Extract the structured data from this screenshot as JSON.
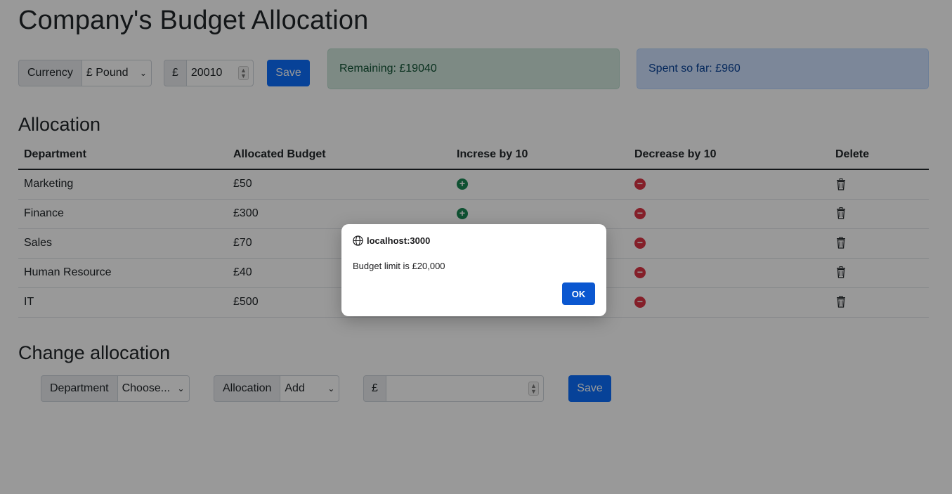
{
  "page": {
    "title": "Company's Budget Allocation"
  },
  "budget_controls": {
    "currency_label": "Currency",
    "currency_selected": "£ Pound",
    "budget_symbol": "£",
    "budget_value": "20010",
    "save_label": "Save"
  },
  "status": {
    "remaining": "Remaining: £19040",
    "spent": "Spent so far: £960"
  },
  "allocation": {
    "heading": "Allocation",
    "columns": [
      "Department",
      "Allocated Budget",
      "Increse by 10",
      "Decrease by 10",
      "Delete"
    ],
    "rows": [
      {
        "department": "Marketing",
        "budget": "£50"
      },
      {
        "department": "Finance",
        "budget": "£300"
      },
      {
        "department": "Sales",
        "budget": "£70"
      },
      {
        "department": "Human Resource",
        "budget": "£40"
      },
      {
        "department": "IT",
        "budget": "£500"
      }
    ]
  },
  "change_allocation": {
    "heading": "Change allocation",
    "department_label": "Department",
    "department_selected": "Choose...",
    "allocation_label": "Allocation",
    "allocation_selected": "Add",
    "amount_symbol": "£",
    "amount_value": "",
    "save_label": "Save"
  },
  "dialog": {
    "origin": "localhost:3000",
    "message": "Budget limit is £20,000",
    "ok_label": "OK"
  },
  "icons": {
    "increase": "plus-circle-icon",
    "decrease": "minus-circle-icon",
    "delete": "trash-icon",
    "origin": "globe-icon"
  },
  "colors": {
    "primary": "#0d6efd",
    "success_bg": "#d1e7dd",
    "primary_bg": "#cfe2ff",
    "increase": "#198754",
    "decrease": "#dc3545",
    "dialog_ok": "#0b57d0"
  }
}
